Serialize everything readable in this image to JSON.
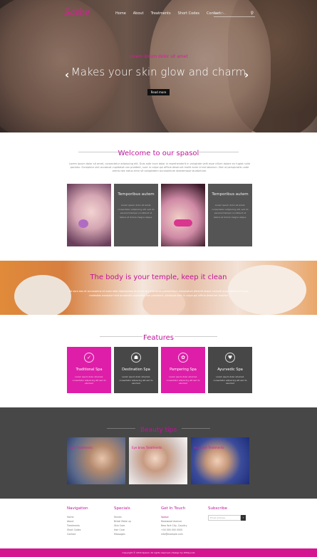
{
  "nav": {
    "logo": "Sashe",
    "menu": [
      "Home",
      "About",
      "Treatments",
      "Short Codes",
      "Contact"
    ],
    "search_placeholder": "Search..."
  },
  "hero": {
    "subtitle": "Lorem ipsum dolor sit amet",
    "title": "Makes your skin glow and charm",
    "button": "Read more"
  },
  "welcome": {
    "title": "Welcome to our spasol",
    "text": "Lorem ipsum dolor sit amet, consectetur adipiscing elit. Duis aute irure dolor in reprehenderit in voluptate velit esse cillum dolore eu fugiat nulla pariatur. Excepteur sint occaecat cupidatat non proident, sunt in culpa qui officia deserunt mollit anim id est laborum. Sed ut perspiciatis unde omnis iste natus error sit voluptatem accusantium doloremque laudantium.",
    "tiles": [
      {
        "title": "Temporibus autem",
        "text": "Lorem ipsum dolor sit amet, consectetur adipiscing elit, sed do eiusmod tempor incididunt ut labore et dolore magna aliqua."
      },
      {
        "title": "Temporibus autem",
        "text": "Lorem ipsum dolor sit amet, consectetur adipiscing elit, sed do eiusmod tempor incididunt ut labore et dolore magna aliqua."
      }
    ]
  },
  "band": {
    "title": "The body is your temple, keep it clean",
    "text": "At vero eos et accusamus et iusto odio dignissimos ducimus qui blanditiis praesentium voluptatum deleniti atque corrupti quos dolores et quas molestias excepturi sint occaecati cupiditate non provident, similique sunt in culpa qui officia deserunt mollitia."
  },
  "features": {
    "title": "Features",
    "items": [
      {
        "title": "Traditional Spa",
        "icon": "✓",
        "text": "Lorem ipsum dolor sit amet, consectetur adipiscing elit sed do eiusmod"
      },
      {
        "title": "Destination Spa",
        "icon": "☗",
        "text": "Lorem ipsum dolor sit amet, consectetur adipiscing elit sed do eiusmod"
      },
      {
        "title": "Pampering Spa",
        "icon": "✿",
        "text": "Lorem ipsum dolor sit amet, consectetur adipiscing elit sed do eiusmod"
      },
      {
        "title": "Ayurvedic Spa",
        "icon": "♥",
        "text": "Lorem ipsum dolor sit amet, consectetur adipiscing elit sed do eiusmod"
      }
    ]
  },
  "tips": {
    "title": "Beauty tips",
    "items": [
      "Hair Treatments",
      "Eye brow Treatments",
      "Hair Care Treatments"
    ]
  },
  "footer": {
    "cols": [
      {
        "heading": "Navigation",
        "items": [
          "Home",
          "About",
          "Treatments",
          "Short Codes",
          "Contact"
        ]
      },
      {
        "heading": "Specials",
        "items": [
          "Facials",
          "Bridal Make up",
          "Skin Care",
          "Hair Care",
          "Massages"
        ]
      },
      {
        "heading": "Get In Touch",
        "items": [
          "Spasol",
          "Rosewood Avenue",
          "New York City, Country",
          "+00 000 000 0000",
          "info@example.com"
        ]
      },
      {
        "heading": "Subscribe",
        "items": [
          "Email address"
        ]
      }
    ],
    "copyright": "Copyright © 2016 Spasol. All rights reserved | Design by W3layouts"
  }
}
